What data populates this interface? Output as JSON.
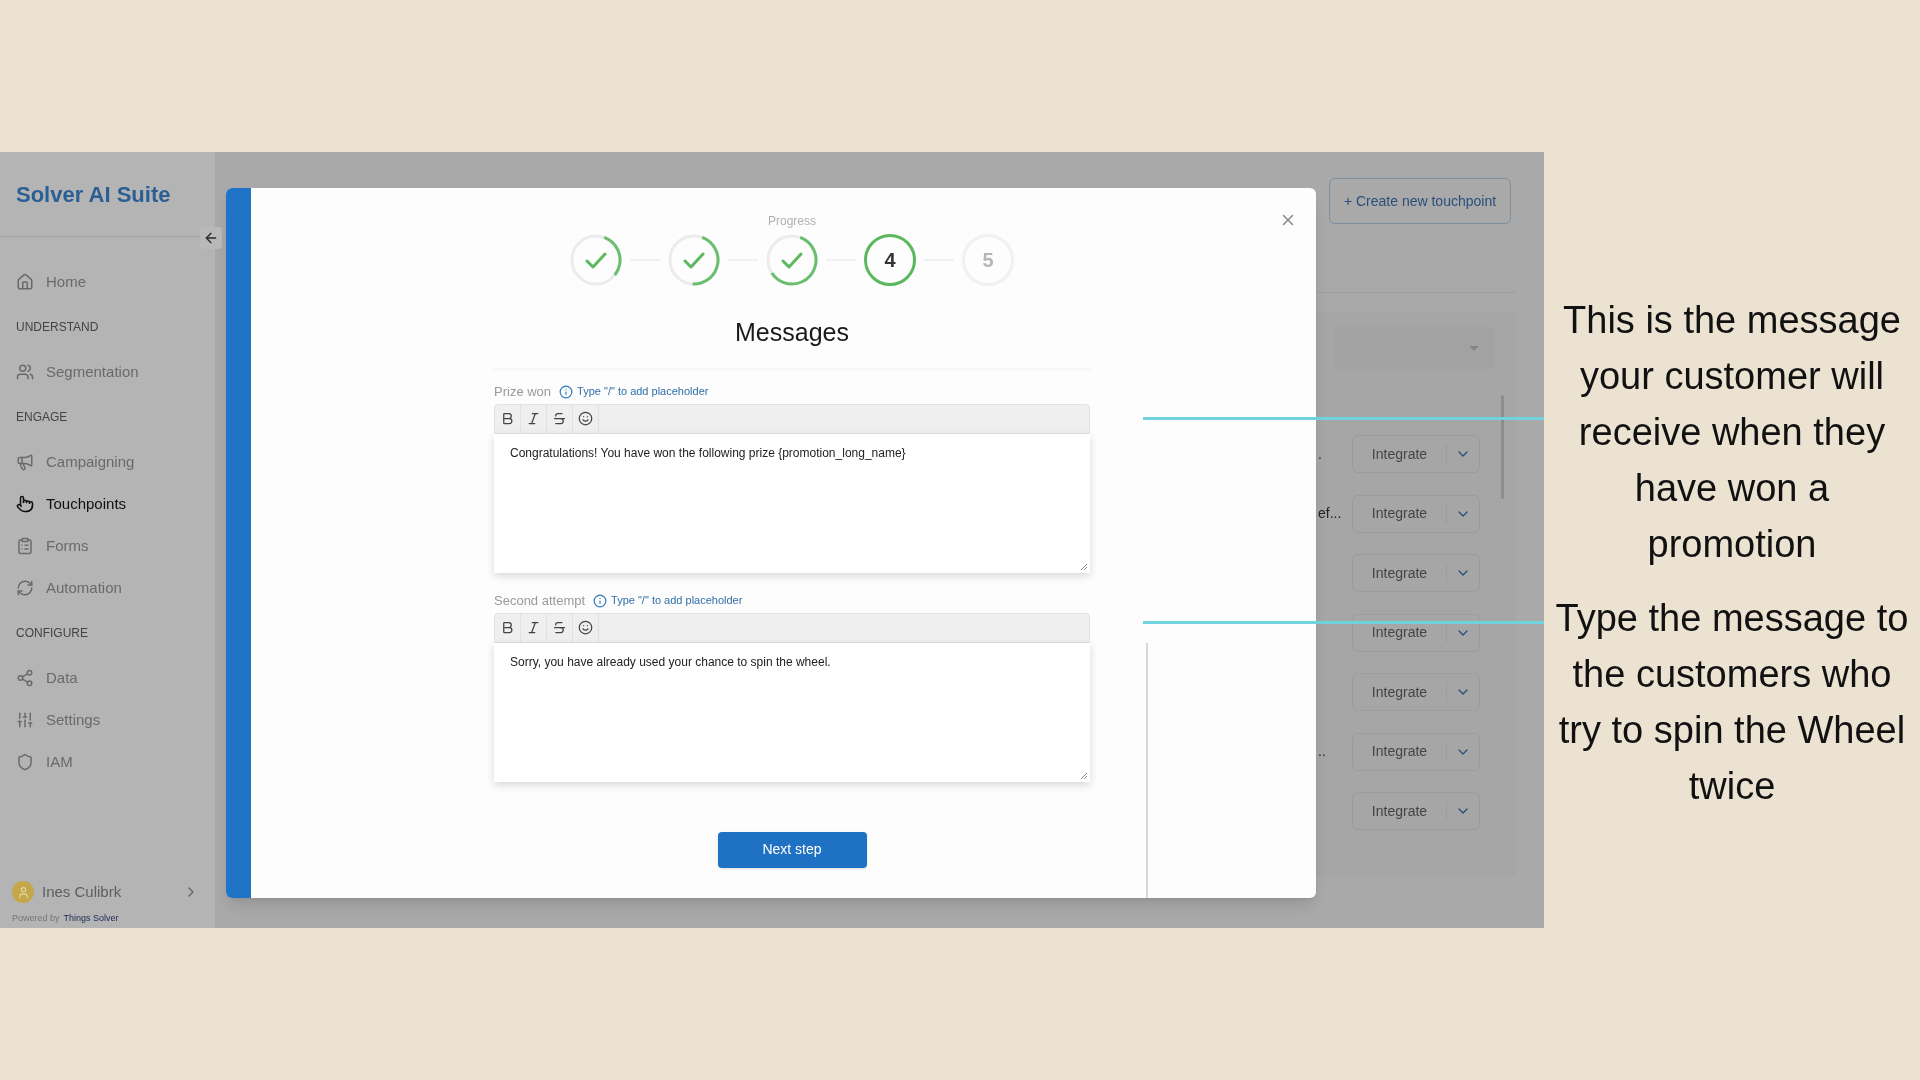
{
  "app": {
    "brand": "Solver AI Suite",
    "sidebar": {
      "items": [
        {
          "kind": "link",
          "label": "Home",
          "selected": false
        },
        {
          "kind": "section",
          "label": "UNDERSTAND"
        },
        {
          "kind": "link",
          "label": "Segmentation",
          "selected": false
        },
        {
          "kind": "section",
          "label": "ENGAGE"
        },
        {
          "kind": "link",
          "label": "Campaigning",
          "selected": false
        },
        {
          "kind": "link",
          "label": "Touchpoints",
          "selected": true
        },
        {
          "kind": "link",
          "label": "Forms",
          "selected": false
        },
        {
          "kind": "link",
          "label": "Automation",
          "selected": false
        },
        {
          "kind": "section",
          "label": "CONFIGURE"
        },
        {
          "kind": "link",
          "label": "Data",
          "selected": false
        },
        {
          "kind": "link",
          "label": "Settings",
          "selected": false
        },
        {
          "kind": "link",
          "label": "IAM",
          "selected": false
        }
      ],
      "user": {
        "name": "Ines Culibrk"
      },
      "footer": {
        "prefix": "Powered by",
        "link": "Things Solver"
      }
    },
    "background": {
      "create_button": "+ Create new touchpoint",
      "rows": [
        {
          "snippet": ".",
          "action": "Integrate"
        },
        {
          "snippet": "ef...",
          "action": "Integrate"
        },
        {
          "action": "Integrate"
        },
        {
          "action": "Integrate"
        },
        {
          "action": "Integrate"
        },
        {
          "snippet": "..",
          "action": "Integrate"
        },
        {
          "action": "Integrate"
        }
      ]
    },
    "modal": {
      "progress_label": "Progress",
      "steps": [
        {
          "kind": "done"
        },
        {
          "kind": "done"
        },
        {
          "kind": "done"
        },
        {
          "kind": "current",
          "label": "4"
        },
        {
          "kind": "upcoming",
          "label": "5"
        }
      ],
      "title": "Messages",
      "fields": [
        {
          "label": "Prize won",
          "hint": "Type \"/\" to add placeholder",
          "value": "Congratulations! You have won the following prize {promotion_long_name}"
        },
        {
          "label": "Second attempt",
          "hint": "Type \"/\" to add placeholder",
          "value": "Sorry, you have already used your chance to spin the wheel."
        }
      ],
      "next_button": "Next step"
    }
  },
  "annotations": [
    {
      "text": "This is the message your customer will receive when they have won a promotion"
    },
    {
      "text": "Type the message to the customers who try to spin the Wheel twice"
    }
  ]
}
